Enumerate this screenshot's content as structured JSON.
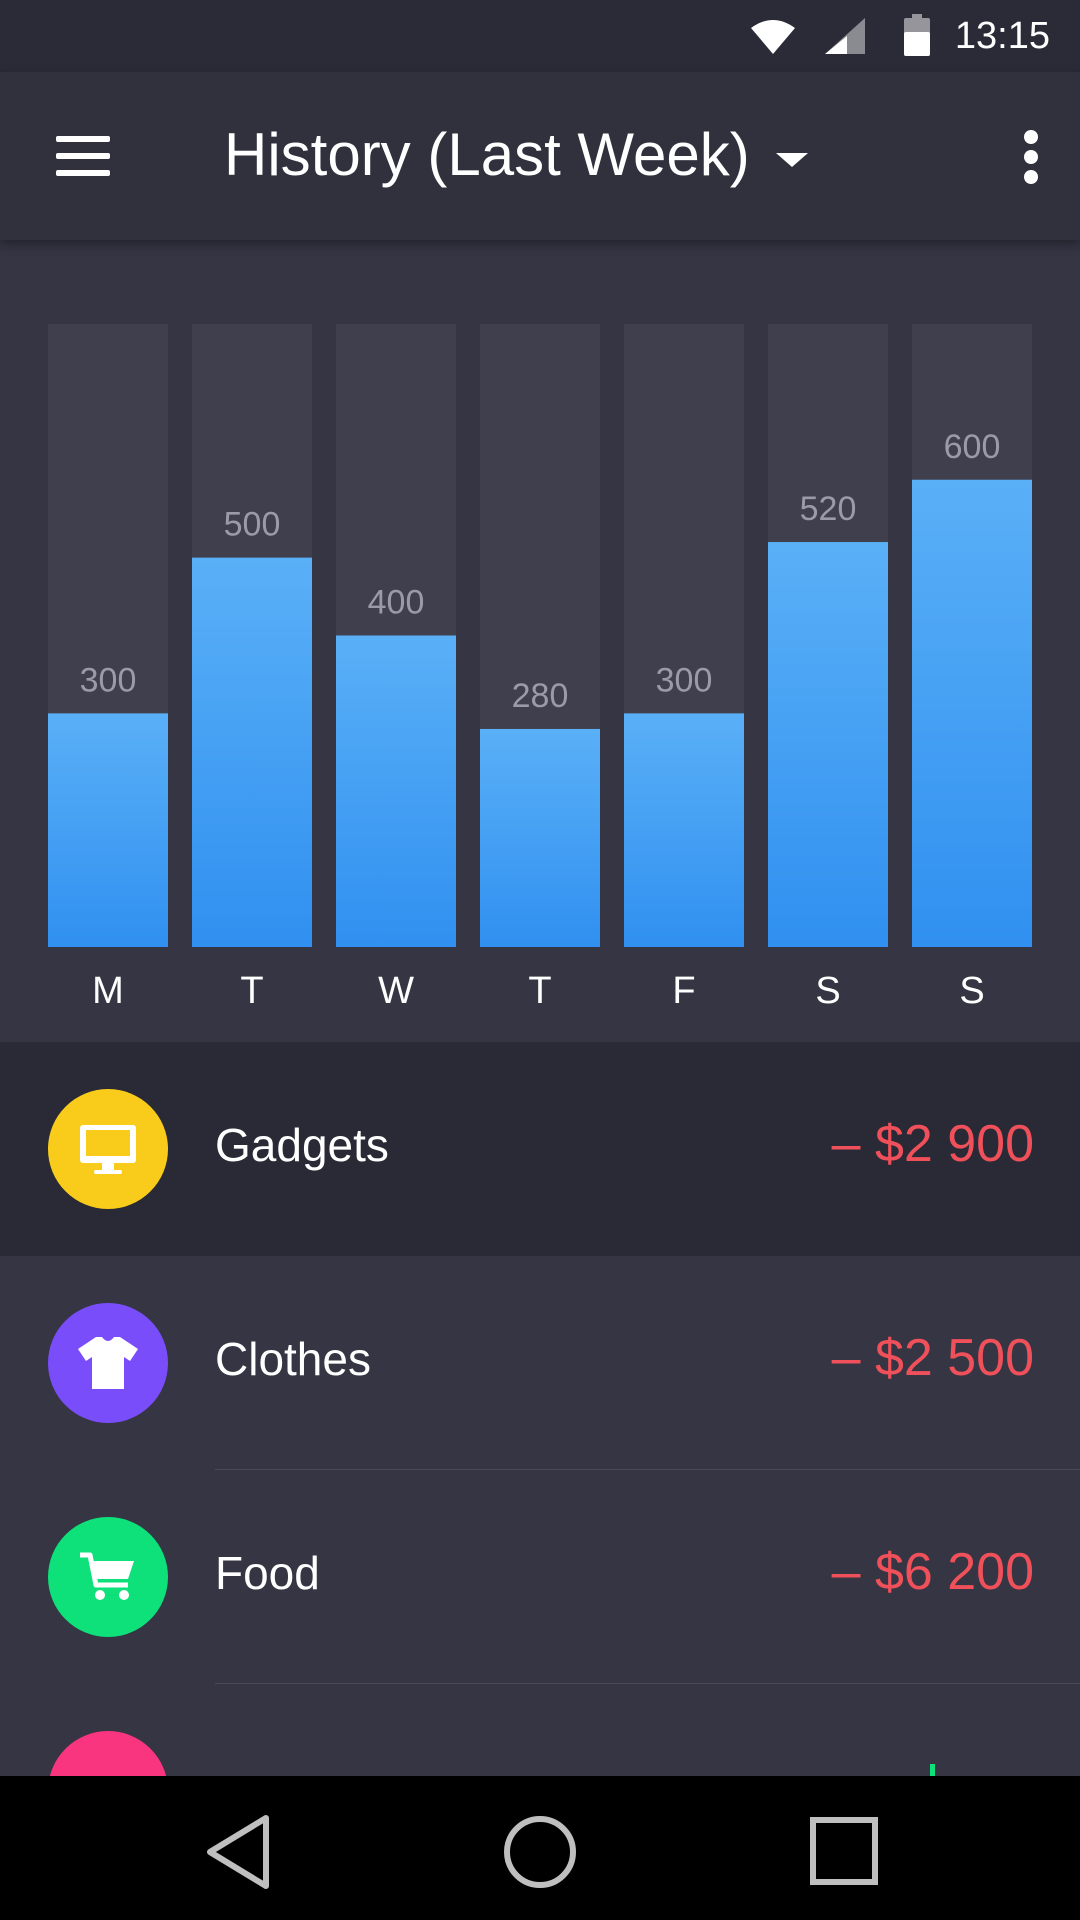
{
  "status_bar": {
    "time": "13:15",
    "icons": [
      "wifi-icon",
      "cellular-signal-icon",
      "battery-icon"
    ]
  },
  "app_bar": {
    "title": "History (Last Week)",
    "menu_icon": "hamburger-menu-icon",
    "dropdown_icon": "caret-down-icon",
    "overflow_icon": "more-vert-icon"
  },
  "chart_data": {
    "type": "bar",
    "categories": [
      "M",
      "T",
      "W",
      "T",
      "F",
      "S",
      "S"
    ],
    "values": [
      300,
      500,
      400,
      280,
      300,
      520,
      600
    ],
    "data_labels": [
      "300",
      "500",
      "400",
      "280",
      "300",
      "520",
      "600"
    ],
    "title": "",
    "xlabel": "",
    "ylabel": "",
    "ylim": [
      0,
      800
    ],
    "grid": false,
    "colors": {
      "bar_top": "#5ab0f7",
      "bar_bottom": "#3090f0",
      "track": "#3f3f4d",
      "value_label": "#9a9aa8"
    }
  },
  "list": {
    "items": [
      {
        "label": "Gadgets",
        "amount": "– $2 900",
        "icon": "monitor-icon",
        "color": "#f9cc1c",
        "selected": true
      },
      {
        "label": "Clothes",
        "amount": "– $2 500",
        "icon": "tshirt-icon",
        "color": "#7a4dfa",
        "selected": false
      },
      {
        "label": "Food",
        "amount": "– $6 200",
        "icon": "shopping-cart-icon",
        "color": "#0ee07a",
        "selected": false
      }
    ],
    "partial_item_color": "#f8357e"
  },
  "nav_bar": {
    "icons": [
      "back-icon",
      "home-icon",
      "recents-icon"
    ]
  }
}
